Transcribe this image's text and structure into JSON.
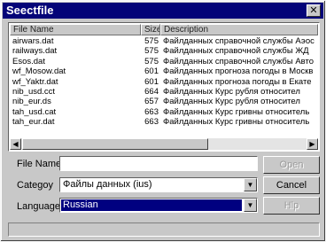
{
  "window": {
    "title": "Seectfile",
    "close_glyph": "✕"
  },
  "file_list": {
    "columns": [
      "File Name",
      "Size",
      "Description"
    ],
    "rows": [
      {
        "name": "airwars.dat",
        "size": "575",
        "description": "Файлданных справочной службы Аэос"
      },
      {
        "name": "railways.dat",
        "size": "575",
        "description": "Файлданных справочной службы ЖД"
      },
      {
        "name": "Esos.dat",
        "size": "575",
        "description": "Файлданных справочной службы Авто"
      },
      {
        "name": "wf_Mosow.dat",
        "size": "601",
        "description": "Файлданных прогноза погоды в Москв"
      },
      {
        "name": "wf_Yaktr.dat",
        "size": "601",
        "description": "Файлданных прогноза погоды в Екате"
      },
      {
        "name": "nib_usd.cct",
        "size": "664",
        "description": "Файлданных Курс рубля относител"
      },
      {
        "name": "nib_eur.ds",
        "size": "657",
        "description": "Файлданных Курс рубля относител"
      },
      {
        "name": "tah_usd.cat",
        "size": "663",
        "description": "Файлданных Курс гривны относитель"
      },
      {
        "name": "tah_eur.dat",
        "size": "663",
        "description": "Файлданных Курс гривны относитель"
      }
    ]
  },
  "form": {
    "file_name_label": "File Name",
    "file_name_value": "",
    "category_label": "Categoy",
    "category_value": "Файлы данных (ius)",
    "language_label": "Language",
    "language_value": "Russian"
  },
  "buttons": {
    "open": "Open",
    "cancel": "Cancel",
    "help": "Hlp"
  },
  "icons": {
    "dropdown": "▼",
    "scroll_left": "◀",
    "scroll_right": "▶"
  },
  "colors": {
    "titlebar": "#040478",
    "selection": "#000080",
    "face": "#c8c8c8"
  }
}
